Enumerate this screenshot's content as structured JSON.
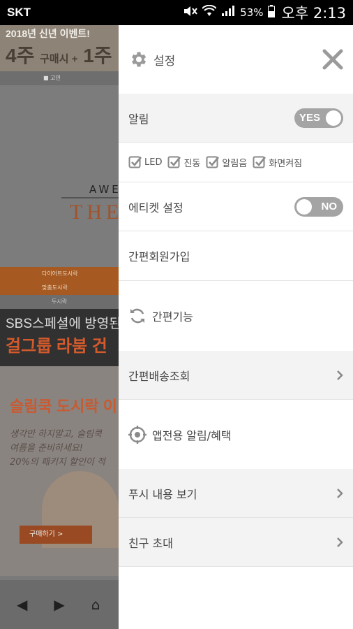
{
  "status_bar": {
    "carrier": "SKT",
    "battery": "53%",
    "time": "오후 2:13"
  },
  "background_page": {
    "promo_line1": "2018년 신년 이벤트!",
    "promo_line2": "4주",
    "promo_line2_small": "구매시 +",
    "promo_line2_tail": "1주",
    "tab_label": "■ 고민",
    "brand_top": "AWE",
    "brand_main": "THE",
    "menu_items": [
      "다이어트도시락",
      "맞춤도시락",
      "두시락"
    ],
    "sbs_line": "SBS스페셜에 방영된 그",
    "group_line": "걸그룹 라붐 건",
    "lunch_title": "슬림쿡 도시락 이",
    "lunch_sub1": "생각만 하지말고, 슬림쿡",
    "lunch_sub2": "여름을 준비하세요!",
    "lunch_sub3": "20%의 패키지 할인이 적",
    "buy_button": "구매하기  >"
  },
  "drawer": {
    "title": "설정",
    "alarm": {
      "label": "알림",
      "toggle": "YES"
    },
    "checks": [
      {
        "label": "LED",
        "checked": true
      },
      {
        "label": "진동",
        "checked": true
      },
      {
        "label": "알림음",
        "checked": true
      },
      {
        "label": "화면켜짐",
        "checked": true
      }
    ],
    "etiquette": {
      "label": "에티켓 설정",
      "toggle": "NO"
    },
    "signup": "간편회원가입",
    "quick_section": "간편기능",
    "delivery": "간편배송조회",
    "app_section": "앱전용 알림/혜택",
    "push_view": "푸시 내용 보기",
    "invite": "친구 초대"
  },
  "colors": {
    "toggle_bg": "#a4a4a4",
    "divider": "#e3e3e3",
    "icon_gray": "#9a9a9a",
    "accent_orange": "#a65a22"
  }
}
